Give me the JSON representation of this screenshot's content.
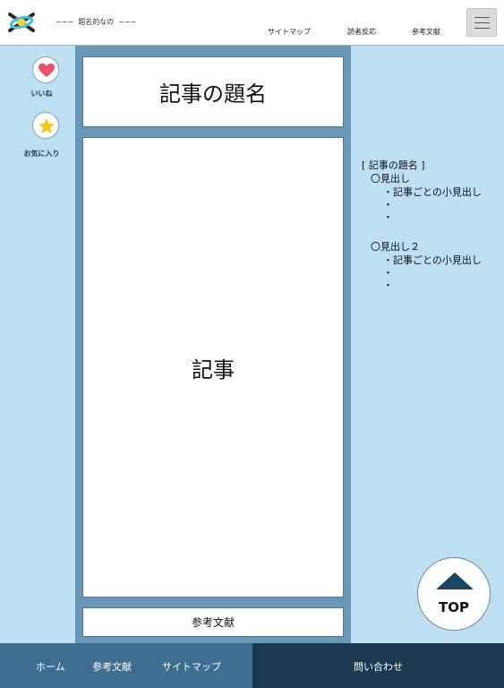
{
  "header": {
    "site_title": "−−−  題名的なの  −−−",
    "nav": {
      "sitemap": "サイトマップ",
      "reactions": "読者反応",
      "references": "参考文献"
    }
  },
  "actions": {
    "like_label": "いいね",
    "favorite_label": "お気に入り"
  },
  "article": {
    "title": "記事の題名",
    "body": "記事",
    "references_button": "参考文献"
  },
  "toc": {
    "title": "[ 記事の題名 ]",
    "section1": "〇見出し",
    "section1_sub": "・記事ごとの小見出し",
    "section1_dot1": "・",
    "section1_dot2": "・",
    "section2": "〇見出し２",
    "section2_sub": "・記事ごとの小見出し",
    "section2_dot1": "・",
    "section2_dot2": "・"
  },
  "top_button": "TOP",
  "footer": {
    "home": "ホーム",
    "references": "参考文献",
    "sitemap": "サイトマップ",
    "contact": "問い合わせ"
  },
  "colors": {
    "sidebar": "#bcdff2",
    "main_column": "#6b97b6",
    "footer_left": "#3c6e8f",
    "footer_right": "#1a3a52",
    "heart": "#f0506e",
    "star": "#f5c518"
  }
}
